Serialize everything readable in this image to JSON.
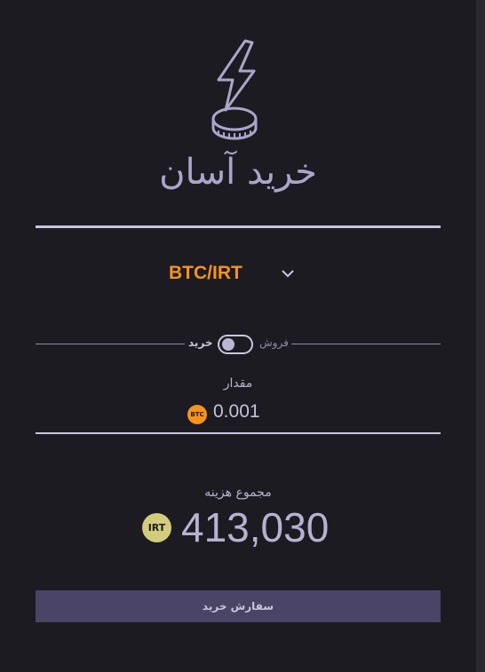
{
  "header": {
    "title": "خرید آسان",
    "logo_icon": "lightning-coin-icon"
  },
  "pair": {
    "label": "BTC/IRT",
    "dropdown_icon": "chevron-down-icon"
  },
  "toggle": {
    "buy_label": "خرید",
    "sell_label": "فروش",
    "selected": "buy"
  },
  "amount": {
    "label": "مقدار",
    "value": "0.001",
    "coin_badge": "BTC"
  },
  "total": {
    "label": "مجموع هزینه",
    "value": "413,030",
    "coin_badge": "IRT"
  },
  "submit": {
    "label": "سفارش خرید"
  },
  "colors": {
    "background": "#1c1b21",
    "accent": "#a9a6c9",
    "btc": "#f7931a",
    "irt": "#d3cc7c",
    "button": "#4a4566"
  }
}
